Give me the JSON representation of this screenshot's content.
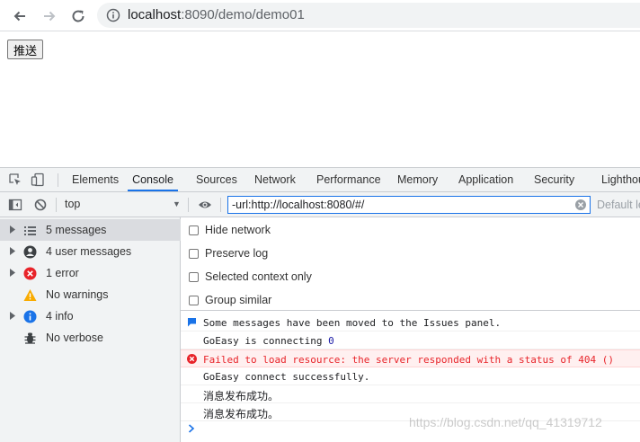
{
  "browser": {
    "url_host": "localhost",
    "url_rest": ":8090/demo/demo01"
  },
  "page": {
    "push_button_label": "推送"
  },
  "devtools": {
    "tabs": [
      "Elements",
      "Console",
      "Sources",
      "Network",
      "Performance",
      "Memory",
      "Application",
      "Security",
      "Lighthouse"
    ],
    "active_tab": "Console",
    "context": "top",
    "filter_value": "-url:http://localhost:8080/#/",
    "default_levels": "Default levels",
    "sidebar": [
      {
        "label": "5 messages",
        "icon": "list-icon"
      },
      {
        "label": "4 user messages",
        "icon": "user-icon"
      },
      {
        "label": "1 error",
        "icon": "error-icon"
      },
      {
        "label": "No warnings",
        "icon": "warning-icon"
      },
      {
        "label": "4 info",
        "icon": "info-icon"
      },
      {
        "label": "No verbose",
        "icon": "bug-icon"
      }
    ],
    "settings": [
      {
        "label": "Hide network"
      },
      {
        "label": "Preserve log"
      },
      {
        "label": "Selected context only"
      },
      {
        "label": "Group similar"
      }
    ],
    "messages": [
      {
        "text": "Some messages have been moved to the Issues panel."
      },
      {
        "text_a": "GoEasy is connecting ",
        "number": "0"
      },
      {
        "text": "Failed to load resource: the server responded with a status of 404 ()"
      },
      {
        "text": "GoEasy connect successfully."
      },
      {
        "text": "消息发布成功。"
      },
      {
        "text": "消息发布成功。"
      }
    ]
  },
  "watermark": "https://blog.csdn.net/qq_41319712",
  "colors": {
    "accent": "#1a73e8",
    "error": "#e8242a",
    "warning": "#f9ab00",
    "info": "#1a73e8"
  }
}
